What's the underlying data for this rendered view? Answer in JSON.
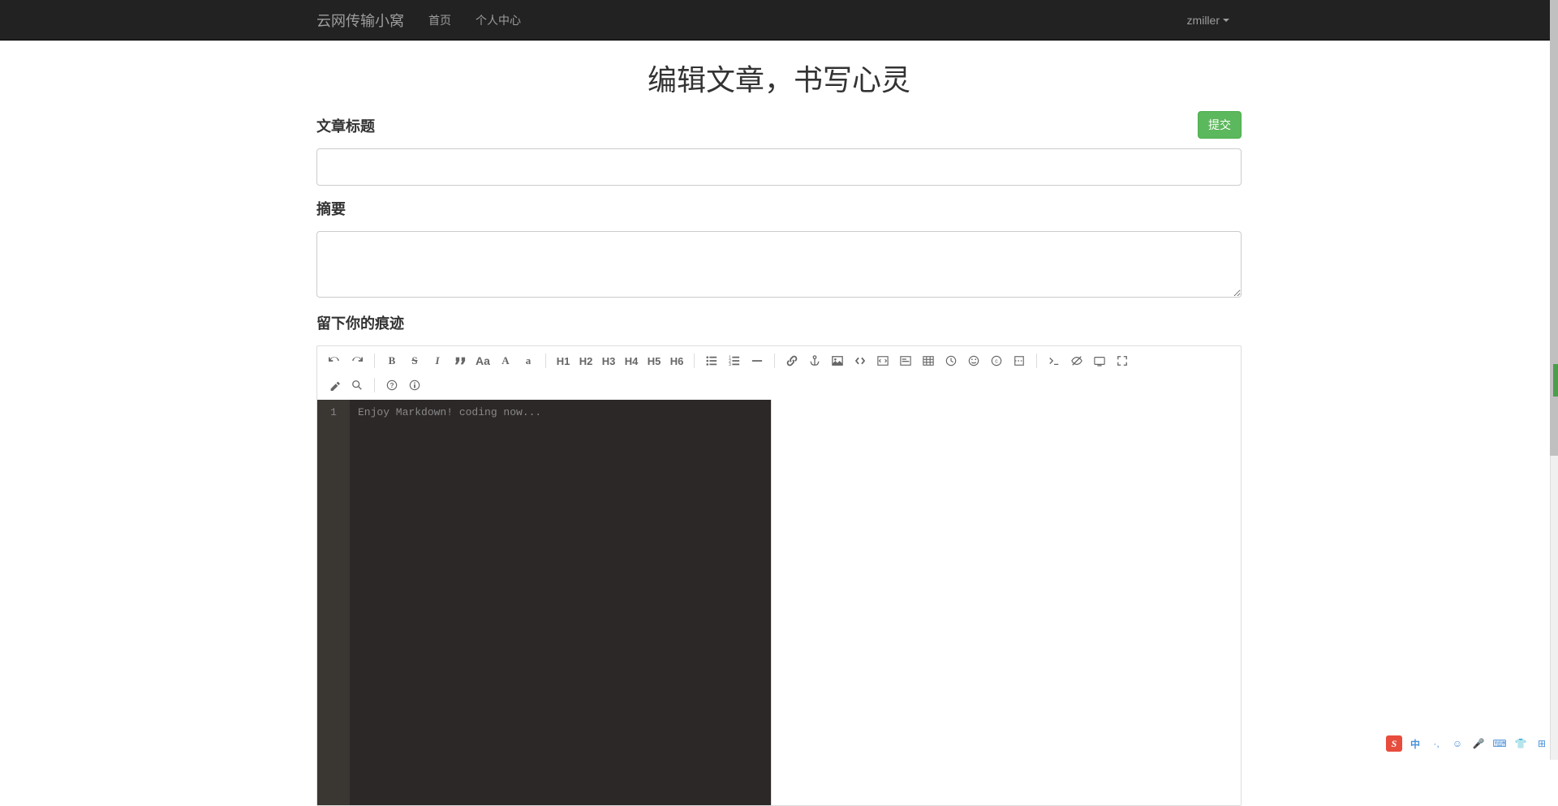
{
  "navbar": {
    "brand": "云网传输小窝",
    "home": "首页",
    "personal": "个人中心",
    "user": "zmiller"
  },
  "page": {
    "title": "编辑文章，书写心灵"
  },
  "labels": {
    "article_title": "文章标题",
    "abstract": "摘要",
    "content": "留下你的痕迹",
    "submit": "提交"
  },
  "form": {
    "title_value": "",
    "abstract_value": ""
  },
  "editor": {
    "line_number": "1",
    "placeholder": "Enjoy Markdown! coding now...",
    "value": ""
  },
  "toolbar": {
    "h1": "H1",
    "h2": "H2",
    "h3": "H3",
    "h4": "H4",
    "h5": "H5",
    "h6": "H6",
    "Aa": "Aa",
    "A_up": "A",
    "a_low": "a"
  },
  "ime": {
    "logo": "S",
    "lang": "中",
    "punct": "·,"
  }
}
